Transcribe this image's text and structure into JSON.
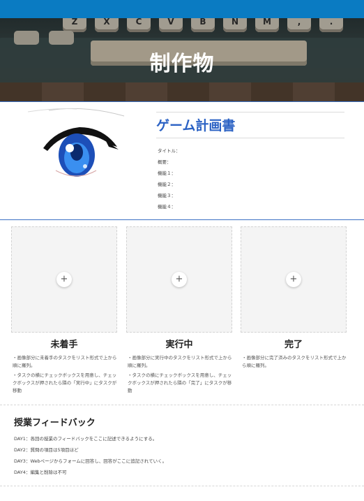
{
  "hero": {
    "title": "制作物",
    "keys": [
      "Z",
      "X",
      "C",
      "V",
      "B",
      "N",
      "M",
      ",",
      "."
    ]
  },
  "document": {
    "title": "ゲーム計画書",
    "fields": [
      "タイトル：",
      "概要：",
      "機能１：",
      "機能２：",
      "機能３：",
      "機能４："
    ]
  },
  "columns": [
    {
      "title": "未着手",
      "paragraphs": [
        "・画像部分に未着手のタスクをリスト形式で上から順に羅列。",
        "・タスクの横にチェックボックスを用意し、チェックボックスが押されたら隣の「実行中」にタスクが移動"
      ]
    },
    {
      "title": "実行中",
      "paragraphs": [
        "・画像部分に実行中のタスクをリスト形式で上から順に羅列。",
        "・タスクの横にチェックボックスを用意し、チェックボックスが押されたら隣の「完了」にタスクが移動"
      ]
    },
    {
      "title": "完了",
      "paragraphs": [
        "・画像部分に完了済みのタスクをリスト形式で上から順に羅列。"
      ]
    }
  ],
  "add_icon": "+",
  "feedback": {
    "title": "授業フィードバック",
    "days": [
      "DAY1：各回の授業のフィードバックをここに記述できるようにする。",
      "DAY2：質問の項目は5項目ほど",
      "DAY3：Webページからフォームに回答し、回答がここに追記されていく。",
      "DAY4：編集と削除は不可"
    ]
  },
  "colors": {
    "topbar": "#0a7bc2",
    "accent": "#2b62c4",
    "divider": "#3a6fc4"
  }
}
